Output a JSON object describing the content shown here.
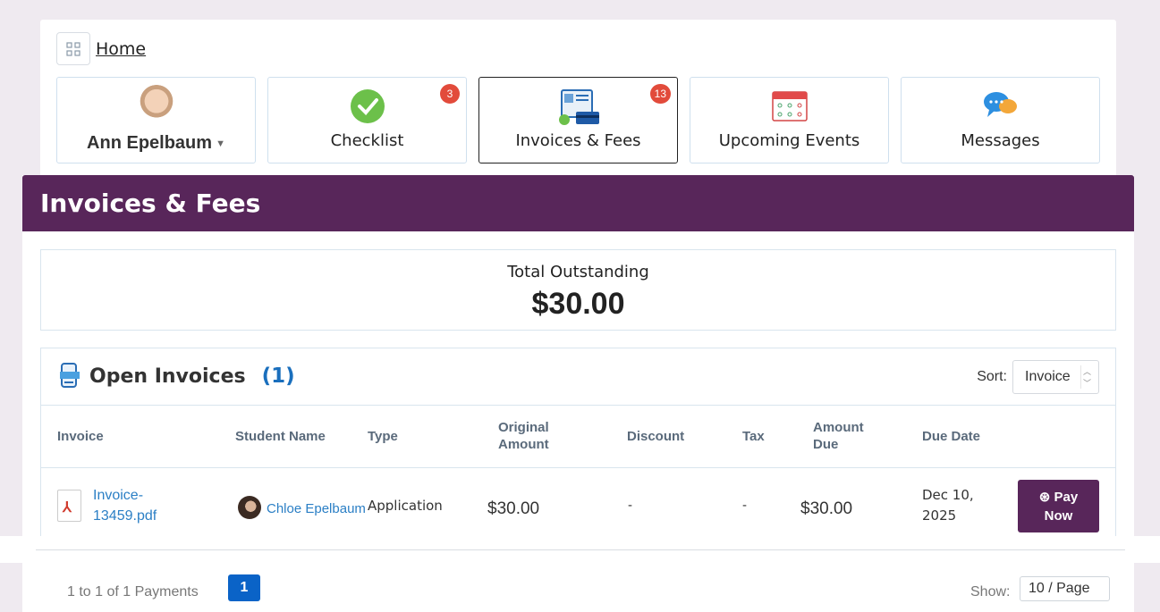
{
  "breadcrumb": {
    "home_label": "Home"
  },
  "user": {
    "name": "Ann Epelbaum"
  },
  "tiles": [
    {
      "label": "Checklist",
      "badge": "3",
      "icon": "checkmark-circle-icon"
    },
    {
      "label": "Invoices & Fees",
      "badge": "13",
      "icon": "invoice-card-icon",
      "active": true
    },
    {
      "label": "Upcoming Events",
      "badge": "",
      "icon": "calendar-icon"
    },
    {
      "label": "Messages",
      "badge": "",
      "icon": "chat-bubbles-icon"
    }
  ],
  "panel": {
    "title": "Invoices & Fees"
  },
  "outstanding": {
    "label": "Total Outstanding",
    "value": "$30.00"
  },
  "open_invoices": {
    "title": "Open Invoices",
    "count": "(1)",
    "sort_label": "Sort:",
    "sort_value": "Invoice",
    "columns": {
      "invoice": "Invoice",
      "student": "Student Name",
      "type": "Type",
      "original_1": "Original",
      "original_2": "Amount",
      "discount": "Discount",
      "tax": "Tax",
      "amount_due_1": "Amount",
      "amount_due_2": "Due",
      "due_date": "Due Date"
    },
    "rows": [
      {
        "invoice_1": "Invoice-",
        "invoice_2": "13459.pdf",
        "student": "Chloe Epelbaum",
        "type": "Application",
        "original": "$30.00",
        "discount": "-",
        "tax": "-",
        "amount_due": "$30.00",
        "due_1": "Dec 10,",
        "due_2": "2025",
        "pay_1": "Pay",
        "pay_2": "Now"
      }
    ]
  },
  "footer": {
    "range": "1 to 1 of 1 Payments",
    "page": "1",
    "show_label": "Show:",
    "show_value": "10 / Page"
  },
  "colors": {
    "brand": "#58265a",
    "badge": "#e24b3b",
    "link": "#2b7fc5",
    "page_active": "#0a63c7"
  }
}
